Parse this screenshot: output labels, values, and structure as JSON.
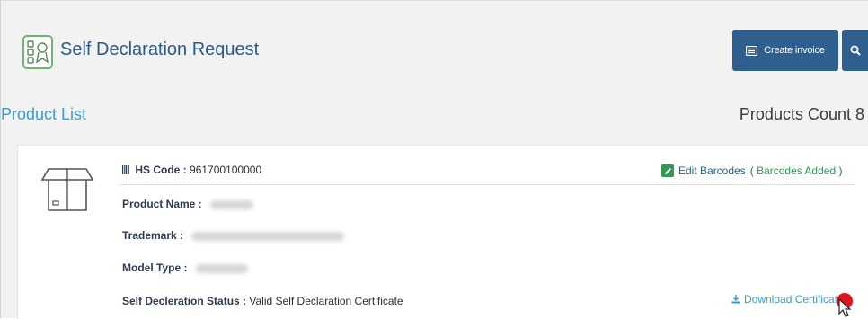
{
  "header": {
    "title": "Self Declaration Request",
    "create_invoice_label": "Create invoice",
    "app_icon": "document-seal-icon",
    "invoice_icon": "list-icon",
    "search_icon": "search-icon"
  },
  "product_list": {
    "title": "Product List",
    "count_label": "Products Count 8"
  },
  "product": {
    "hs_code_label": "HS Code :",
    "hs_code_value": "961700100000",
    "product_name_label": "Product Name :",
    "trademark_label": "Trademark :",
    "model_type_label": "Model Type :",
    "status_label": "Self Decleration Status :",
    "status_value": "Valid Self Declaration Certificate",
    "edit_barcodes_label": "Edit Barcodes",
    "barcodes_added_label": "Barcodes Added",
    "download_label": "Download Certificate"
  },
  "colors": {
    "accent": "#2e5f8e",
    "link": "#3a9bd5",
    "success": "#2f9a55",
    "cursor_highlight": "#e0141e"
  }
}
